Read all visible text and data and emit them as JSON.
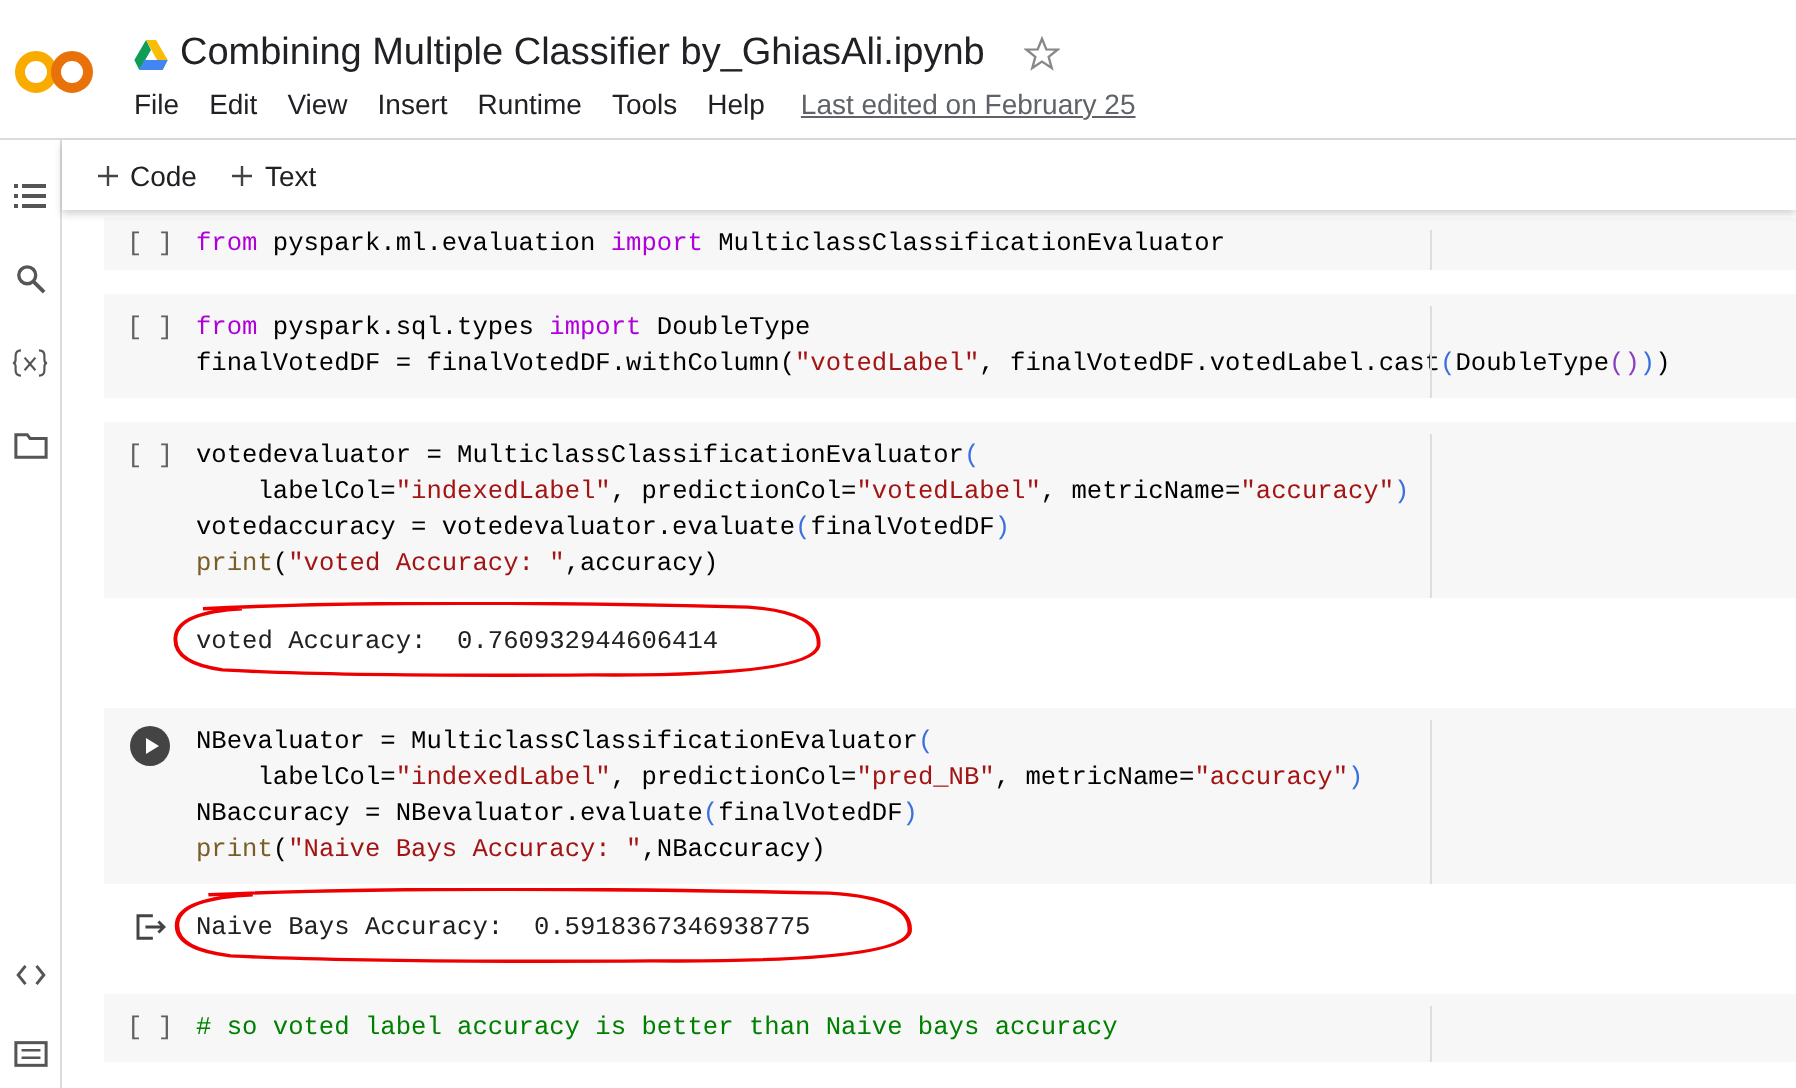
{
  "notebook": {
    "title": "Combining Multiple Classifier by_GhiasAli.ipynb"
  },
  "menu": [
    "File",
    "Edit",
    "View",
    "Insert",
    "Runtime",
    "Tools",
    "Help"
  ],
  "last_edited": "Last edited on February 25",
  "toolbar": [
    {
      "label": "Code"
    },
    {
      "label": "Text"
    }
  ],
  "cells": [
    {
      "gutter": {
        "kind": "brackets",
        "text": "[ ]"
      },
      "lines": [
        [
          {
            "kind": "keyword",
            "text": "from"
          },
          {
            "kind": "plain",
            "text": " pyspark.ml.evaluation "
          },
          {
            "kind": "keyword",
            "text": "import"
          },
          {
            "kind": "plain",
            "text": " MulticlassClassificationEvaluator"
          }
        ]
      ]
    },
    {
      "gutter": {
        "kind": "brackets",
        "text": "[ ]"
      },
      "lines": [
        [
          {
            "kind": "keyword",
            "text": "from"
          },
          {
            "kind": "plain",
            "text": " pyspark.sql.types "
          },
          {
            "kind": "keyword",
            "text": "import"
          },
          {
            "kind": "plain",
            "text": " DoubleType"
          }
        ],
        [
          {
            "kind": "plain",
            "text": "finalVotedDF = finalVotedDF.withColumn("
          },
          {
            "kind": "string",
            "text": "\"votedLabel\""
          },
          {
            "kind": "plain",
            "text": ", finalVotedDF.votedLabel.cast"
          },
          {
            "kind": "paren",
            "text": "("
          },
          {
            "kind": "plain",
            "text": "DoubleType"
          },
          {
            "kind": "paren2",
            "text": "()"
          },
          {
            "kind": "paren",
            "text": ")"
          },
          {
            "kind": "plain",
            "text": ")"
          }
        ]
      ]
    },
    {
      "gutter": {
        "kind": "brackets",
        "text": "[ ]"
      },
      "lines": [
        [
          {
            "kind": "plain",
            "text": "votedevaluator = MulticlassClassificationEvaluator"
          },
          {
            "kind": "paren",
            "text": "("
          }
        ],
        [
          {
            "kind": "plain",
            "text": "    labelCol="
          },
          {
            "kind": "string",
            "text": "\"indexedLabel\""
          },
          {
            "kind": "plain",
            "text": ", predictionCol="
          },
          {
            "kind": "string",
            "text": "\"votedLabel\""
          },
          {
            "kind": "plain",
            "text": ", metricName="
          },
          {
            "kind": "string",
            "text": "\"accuracy\""
          },
          {
            "kind": "paren",
            "text": ")"
          }
        ],
        [
          {
            "kind": "plain",
            "text": "votedaccuracy = votedevaluator.evaluate"
          },
          {
            "kind": "paren",
            "text": "("
          },
          {
            "kind": "plain",
            "text": "finalVotedDF"
          },
          {
            "kind": "paren",
            "text": ")"
          }
        ],
        [
          {
            "kind": "builtin",
            "text": "print"
          },
          {
            "kind": "plain",
            "text": "("
          },
          {
            "kind": "string",
            "text": "\"voted Accuracy: \""
          },
          {
            "kind": "plain",
            "text": ",accuracy)"
          }
        ]
      ],
      "output": {
        "text": "voted Accuracy:  0.760932944606414",
        "circled": true,
        "icon": false
      }
    },
    {
      "gutter": {
        "kind": "run"
      },
      "lines": [
        [
          {
            "kind": "plain",
            "text": "NBevaluator = MulticlassClassificationEvaluator"
          },
          {
            "kind": "paren",
            "text": "("
          }
        ],
        [
          {
            "kind": "plain",
            "text": "    labelCol="
          },
          {
            "kind": "string",
            "text": "\"indexedLabel\""
          },
          {
            "kind": "plain",
            "text": ", predictionCol="
          },
          {
            "kind": "string",
            "text": "\"pred_NB\""
          },
          {
            "kind": "plain",
            "text": ", metricName="
          },
          {
            "kind": "string",
            "text": "\"accuracy\""
          },
          {
            "kind": "paren",
            "text": ")"
          }
        ],
        [
          {
            "kind": "plain",
            "text": "NBaccuracy = NBevaluator.evaluate"
          },
          {
            "kind": "paren",
            "text": "("
          },
          {
            "kind": "plain",
            "text": "finalVotedDF"
          },
          {
            "kind": "paren",
            "text": ")"
          }
        ],
        [
          {
            "kind": "builtin",
            "text": "print"
          },
          {
            "kind": "plain",
            "text": "("
          },
          {
            "kind": "string",
            "text": "\"Naive Bays Accuracy: \""
          },
          {
            "kind": "plain",
            "text": ",NBaccuracy)"
          }
        ]
      ],
      "output": {
        "text": "Naive Bays Accuracy:  0.5918367346938775",
        "circled": true,
        "icon": true
      }
    },
    {
      "gutter": {
        "kind": "brackets",
        "text": "[ ]"
      },
      "lines": [
        [
          {
            "kind": "comment",
            "text": "# so voted label accuracy is better than Naive bays accuracy"
          }
        ]
      ]
    }
  ]
}
